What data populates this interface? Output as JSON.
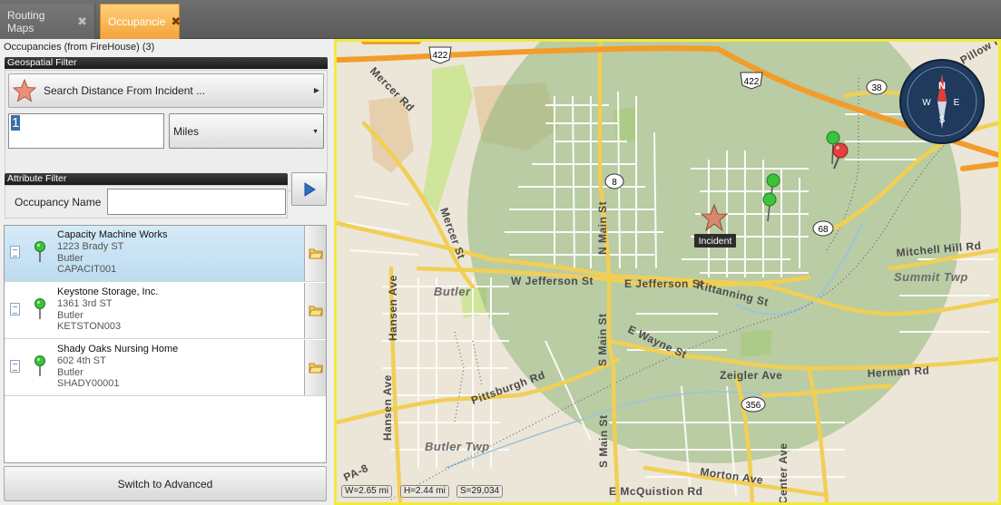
{
  "tabs": [
    {
      "label": "Routing Maps",
      "active": false
    },
    {
      "label": "Occupancie",
      "active": true
    }
  ],
  "panel": {
    "header": "Occupancies (from FireHouse) (3)",
    "geo_title": "Geospatial Filter",
    "search_button": "Search  Distance From Incident ...",
    "distance_value": "1",
    "units_value": "Miles",
    "attr_title": "Attribute Filter",
    "occ_name_label": "Occupancy Name",
    "occ_name_value": "",
    "switch_button": "Switch to Advanced"
  },
  "occupancies": [
    {
      "name": "Capacity Machine Works",
      "address": "1223 Brady ST",
      "city": "Butler",
      "id": "CAPACIT001",
      "selected": true
    },
    {
      "name": "Keystone Storage, Inc.",
      "address": "1361 3rd ST",
      "city": "Butler",
      "id": "KETSTON003",
      "selected": false
    },
    {
      "name": "Shady Oaks Nursing Home",
      "address": "602 4th ST",
      "city": "Butler",
      "id": "SHADY00001",
      "selected": false
    }
  ],
  "map": {
    "incident_label": "Incident",
    "route_shields": [
      "422",
      "422",
      "38",
      "8",
      "68",
      "356"
    ],
    "street_labels": [
      "Mercer Rd",
      "Mercer St",
      "N Main St",
      "S Main St",
      "S Main St",
      "W Jefferson St",
      "E Jefferson St",
      "Kittanning St",
      "E Wayne St",
      "Zeigler Ave",
      "Herman Rd",
      "Mitchell Hill Rd",
      "Hansen Ave",
      "Hansen Ave",
      "Pittsburgh Rd",
      "E McQuistion Rd",
      "Morton Ave",
      "Center Ave",
      "PA-8",
      "Pillow Rd"
    ],
    "place_labels": [
      "Butler",
      "Summit Twp",
      "Butler Twp"
    ],
    "compass_letters": [
      "N",
      "E",
      "S",
      "W"
    ],
    "status": {
      "width": "W=2.65 mi",
      "height": "H=2.44 mi",
      "scale": "S=29,034"
    }
  },
  "colors": {
    "tab_active": "#f3a339",
    "map_border": "#f2ea3b",
    "selection": "#c6e2f4",
    "buffer": "#8fb67a"
  }
}
